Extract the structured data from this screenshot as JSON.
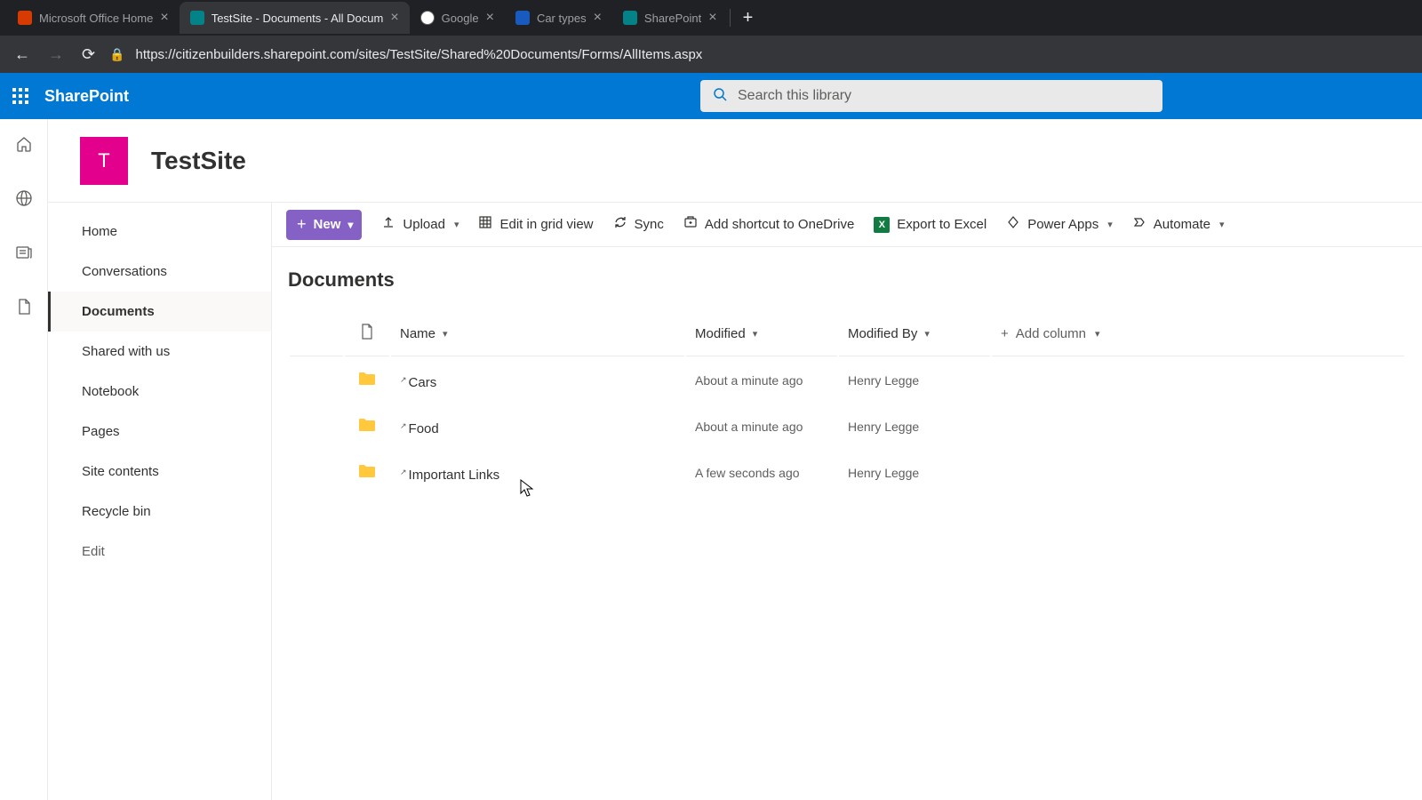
{
  "browser": {
    "tabs": [
      {
        "title": "Microsoft Office Home",
        "active": false,
        "favicon_color": "#d83b01"
      },
      {
        "title": "TestSite - Documents - All Docum",
        "active": true,
        "favicon_color": "#038387"
      },
      {
        "title": "Google",
        "active": false,
        "favicon_color": "#ffffff"
      },
      {
        "title": "Car types",
        "active": false,
        "favicon_color": "#185abd"
      },
      {
        "title": "SharePoint",
        "active": false,
        "favicon_color": "#038387"
      }
    ],
    "url": "https://citizenbuilders.sharepoint.com/sites/TestSite/Shared%20Documents/Forms/AllItems.aspx"
  },
  "suite": {
    "app_name": "SharePoint",
    "search_placeholder": "Search this library"
  },
  "site": {
    "logo_letter": "T",
    "title": "TestSite"
  },
  "leftnav": {
    "items": [
      {
        "label": "Home",
        "active": false
      },
      {
        "label": "Conversations",
        "active": false
      },
      {
        "label": "Documents",
        "active": true
      },
      {
        "label": "Shared with us",
        "active": false
      },
      {
        "label": "Notebook",
        "active": false
      },
      {
        "label": "Pages",
        "active": false
      },
      {
        "label": "Site contents",
        "active": false
      },
      {
        "label": "Recycle bin",
        "active": false
      }
    ],
    "edit_label": "Edit"
  },
  "command_bar": {
    "new": "New",
    "upload": "Upload",
    "edit_grid": "Edit in grid view",
    "sync": "Sync",
    "shortcut": "Add shortcut to OneDrive",
    "export": "Export to Excel",
    "powerapps": "Power Apps",
    "automate": "Automate"
  },
  "library": {
    "title": "Documents",
    "columns": {
      "name": "Name",
      "modified": "Modified",
      "modified_by": "Modified By",
      "add_column": "Add column"
    },
    "rows": [
      {
        "name": "Cars",
        "modified": "About a minute ago",
        "modified_by": "Henry Legge"
      },
      {
        "name": "Food",
        "modified": "About a minute ago",
        "modified_by": "Henry Legge"
      },
      {
        "name": "Important Links",
        "modified": "A few seconds ago",
        "modified_by": "Henry Legge"
      }
    ]
  }
}
